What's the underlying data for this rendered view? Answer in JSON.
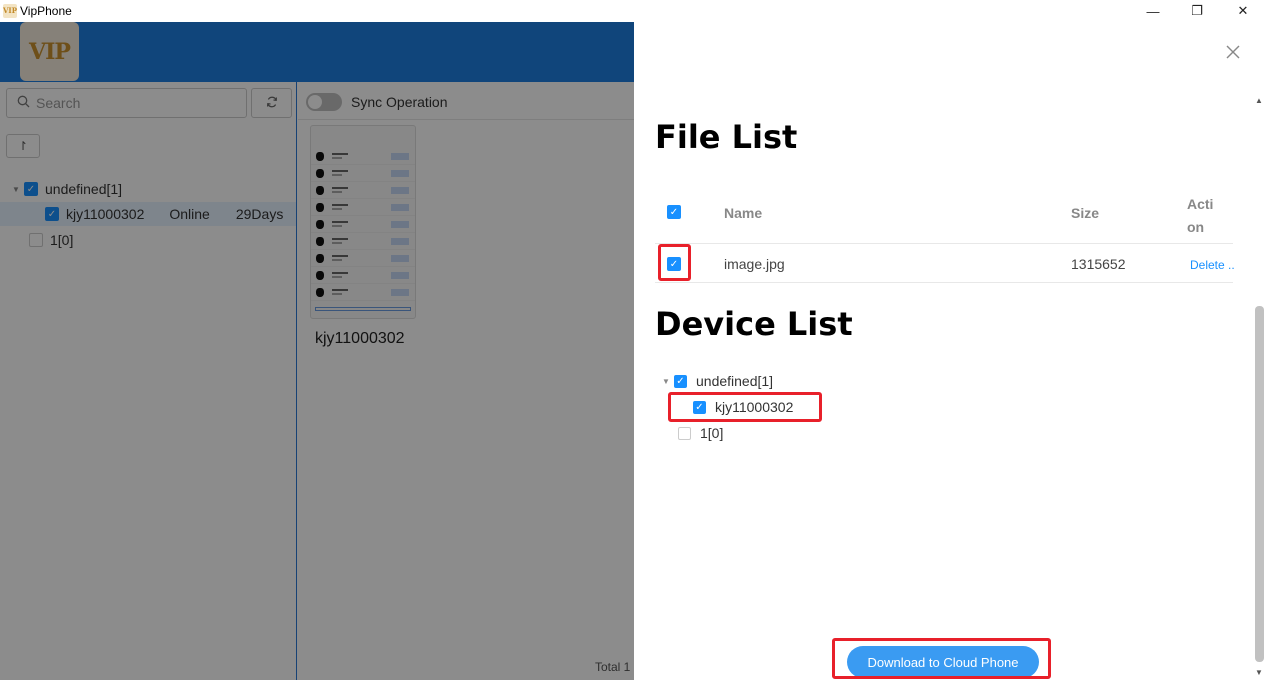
{
  "window": {
    "title": "VipPhone",
    "logo_text": "VIP",
    "minimize": "—",
    "maximize": "❐",
    "close": "✕"
  },
  "sidebar": {
    "search_placeholder": "Search",
    "tree": [
      {
        "label": "undefined[1]",
        "checked": true
      },
      {
        "label": "kjy11000302",
        "status": "Online",
        "days": "29Days",
        "checked": true
      },
      {
        "label": "1[0]",
        "checked": false
      }
    ]
  },
  "main": {
    "sync_label": "Sync Operation",
    "device_name": "kjy11000302",
    "total": "Total 1"
  },
  "drawer": {
    "file_list_title": "File List",
    "columns": {
      "name": "Name",
      "size": "Size",
      "action": "Acti\non"
    },
    "files": [
      {
        "name": "image.jpg",
        "size": "1315652",
        "action": "Delete"
      }
    ],
    "device_list_title": "Device List",
    "device_tree": [
      {
        "label": "undefined[1]",
        "checked": true
      },
      {
        "label": "kjy11000302",
        "checked": true
      },
      {
        "label": "1[0]",
        "checked": false
      }
    ],
    "download_button": "Download to Cloud Phone"
  },
  "colors": {
    "accent": "#1890ff",
    "topbar": "#1e7fe0",
    "highlight": "#e8202a"
  }
}
